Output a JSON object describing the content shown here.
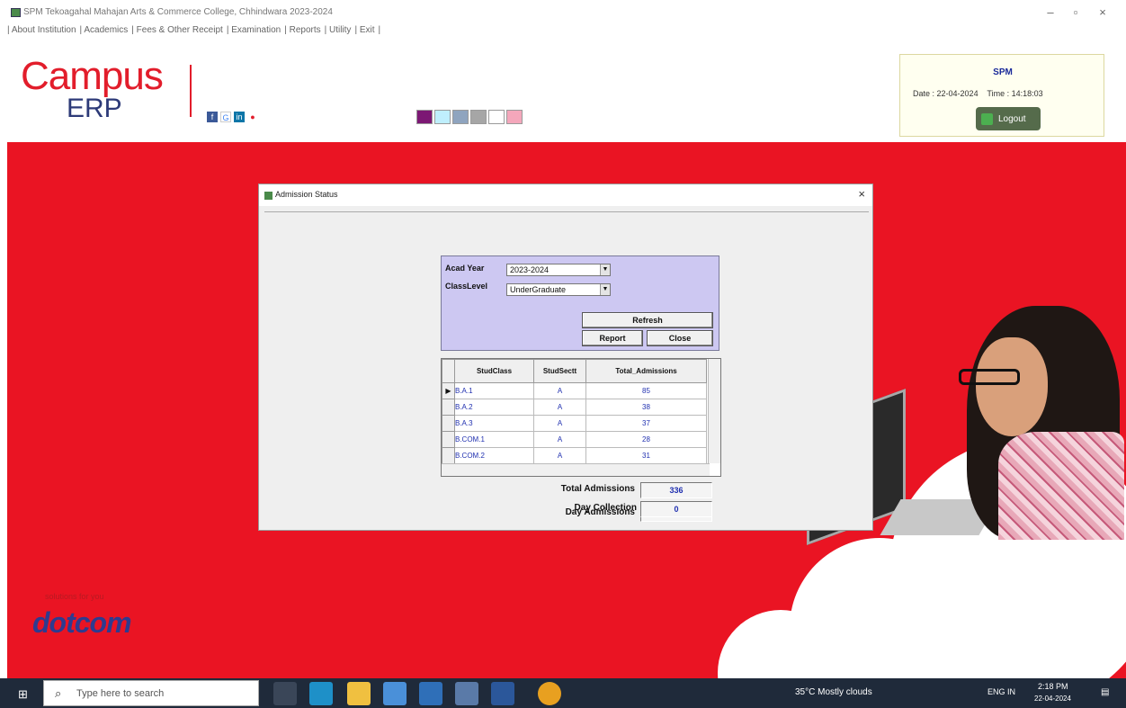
{
  "window": {
    "title": "SPM Tekoagahal Mahajan Arts & Commerce College, Chhindwara 2023-2024",
    "controls": {
      "minimize": "–",
      "maximize": "▫",
      "close": "×"
    }
  },
  "menu": [
    "| About Institution",
    "| Academics",
    "| Fees & Other Receipt",
    "| Examination",
    "| Reports",
    "| Utility",
    "| Exit",
    "|"
  ],
  "header": {
    "logo_top": "Campus",
    "logo_bottom": "ERP",
    "social_icons": [
      "facebook-icon",
      "google-icon",
      "linkedin-icon",
      "pinterest-icon"
    ],
    "swatches": [
      "#7c1874",
      "#bfeffd",
      "#8fa4bf",
      "#a6a6a6",
      "#ffffff",
      "#f4a7bb"
    ],
    "user": "SPM",
    "date_label": "Date :",
    "date_value": "22-04-2024",
    "time_label": "Time :",
    "time_value": "14:18:03",
    "logout_label": "Logout"
  },
  "brand": {
    "tag": "solutions for you",
    "name": "dotcom"
  },
  "dialog": {
    "title": "Admission Status",
    "close": "×",
    "filters": {
      "acad_year_label": "Acad Year",
      "acad_year_value": "2023-2024",
      "class_level_label": "ClassLevel",
      "class_level_value": "UnderGraduate"
    },
    "buttons": {
      "refresh": "Refresh",
      "report": "Report",
      "close": "Close"
    },
    "grid": {
      "columns": [
        "",
        "StudClass",
        "StudSectt",
        "Total_Admissions"
      ],
      "rows": [
        {
          "class": "B.A.1",
          "section": "A",
          "total": "85"
        },
        {
          "class": "B.A.2",
          "section": "A",
          "total": "38"
        },
        {
          "class": "B.A.3",
          "section": "A",
          "total": "37"
        },
        {
          "class": "B.COM.1",
          "section": "A",
          "total": "28"
        },
        {
          "class": "B.COM.2",
          "section": "A",
          "total": "31"
        }
      ]
    },
    "summary": {
      "total_label": "Total Admissions",
      "total_value": "336",
      "day_label": "Day Admissions",
      "day_value": "0",
      "collection_label": "Day Collection",
      "collection_value": "0"
    }
  },
  "taskbar": {
    "search_placeholder": "Type here to search",
    "weather": "35°C  Mostly clouds",
    "lang": "ENG IN",
    "time": "2:18 PM",
    "date": "22-04-2024"
  }
}
